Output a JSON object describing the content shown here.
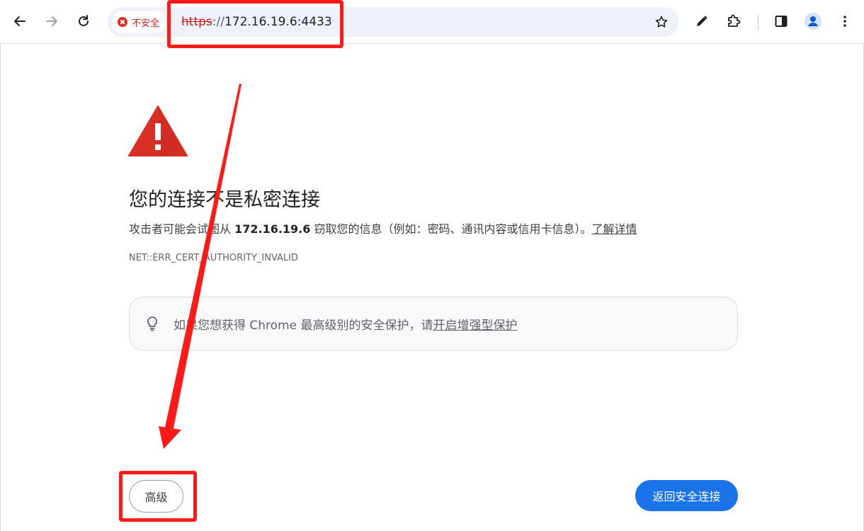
{
  "toolbar": {
    "back_icon": "arrow-left-icon",
    "forward_icon": "arrow-right-icon",
    "reload_icon": "reload-icon",
    "security_label": "不安全",
    "url_scheme": "https",
    "url_separator": "://",
    "url_host": "172.16.19.6:4433",
    "bookmark_icon": "star-icon",
    "edit_icon": "pencil-icon",
    "extensions_icon": "puzzle-icon",
    "side_panel_icon": "side-panel-icon",
    "profile_icon": "person-icon",
    "menu_icon": "kebab-menu-icon"
  },
  "page": {
    "headline": "您的连接不是私密连接",
    "description_prefix": "攻击者可能会试图从 ",
    "description_host": "172.16.19.6",
    "description_suffix": " 窃取您的信息（例如：密码、通讯内容或信用卡信息）。",
    "learn_more": "了解详情",
    "error_code": "NET::ERR_CERT_AUTHORITY_INVALID",
    "enhanced_prefix": "如果您想获得 Chrome 最高级别的安全保护，请",
    "enhanced_link": "开启增强型保护",
    "advanced_button": "高级",
    "back_button": "返回安全连接"
  },
  "colors": {
    "danger": "#d93025",
    "primary_button": "#1a73e8",
    "annotation": "#ff1a1a"
  }
}
